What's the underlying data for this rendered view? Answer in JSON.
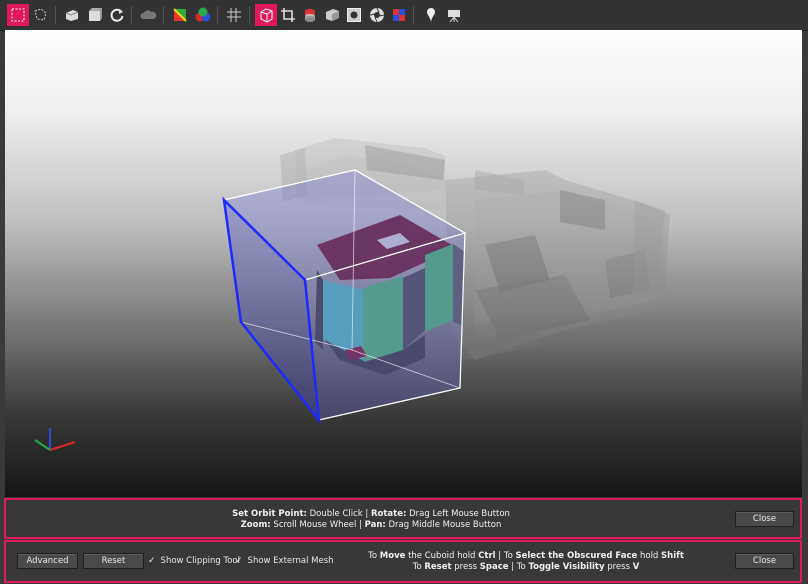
{
  "toolbar": {
    "icons": [
      "select-rect-icon",
      "select-lasso-icon",
      "box-view-icon",
      "cube-view-icon",
      "rotate-icon",
      "cloud-icon",
      "color-layers-icon",
      "rgb-icon",
      "grid-icon",
      "clipping-cuboid-icon",
      "crop-icon",
      "layers-icon",
      "cube-shaded-icon",
      "frame-icon",
      "aperture-icon",
      "flag-icon",
      "marker-icon",
      "camera-icon"
    ]
  },
  "orbit_help": {
    "line1": [
      {
        "text": "Set Orbit Point:",
        "bold": true
      },
      {
        "text": " Double Click | ",
        "bold": false
      },
      {
        "text": "Rotate:",
        "bold": true
      },
      {
        "text": " Drag Left Mouse Button",
        "bold": false
      }
    ],
    "line2": [
      {
        "text": "Zoom:",
        "bold": true
      },
      {
        "text": " Scroll Mouse Wheel | ",
        "bold": false
      },
      {
        "text": "Pan:",
        "bold": true
      },
      {
        "text": " Drag Middle Mouse Button",
        "bold": false
      }
    ],
    "close_label": "Close"
  },
  "clipping_panel": {
    "advanced_label": "Advanced",
    "reset_label": "Reset",
    "show_clipping_tool": "Show Clipping Tool",
    "show_external_mesh": "Show External Mesh",
    "checkmark": "✓",
    "help_line1": [
      {
        "text": "To ",
        "bold": false
      },
      {
        "text": "Move",
        "bold": true
      },
      {
        "text": " the Cuboid hold ",
        "bold": false
      },
      {
        "text": "Ctrl",
        "bold": true
      },
      {
        "text": " | To ",
        "bold": false
      },
      {
        "text": "Select the Obscured Face",
        "bold": true
      },
      {
        "text": " hold ",
        "bold": false
      },
      {
        "text": "Shift",
        "bold": true
      }
    ],
    "help_line2": [
      {
        "text": "To ",
        "bold": false
      },
      {
        "text": "Reset",
        "bold": true
      },
      {
        "text": " press ",
        "bold": false
      },
      {
        "text": "Space",
        "bold": true
      },
      {
        "text": " | To ",
        "bold": false
      },
      {
        "text": "Toggle Visibility",
        "bold": true
      },
      {
        "text": " press ",
        "bold": false
      },
      {
        "text": "V",
        "bold": true
      }
    ],
    "close_label": "Close"
  },
  "colors": {
    "accent": "#e0195a",
    "cuboid_edge": "#ffffff",
    "selected_face_edge": "#1a2bff",
    "wall_green": "#4cb36a",
    "wall_teal": "#4fb7b0",
    "wall_maroon": "#6e1e2c"
  }
}
